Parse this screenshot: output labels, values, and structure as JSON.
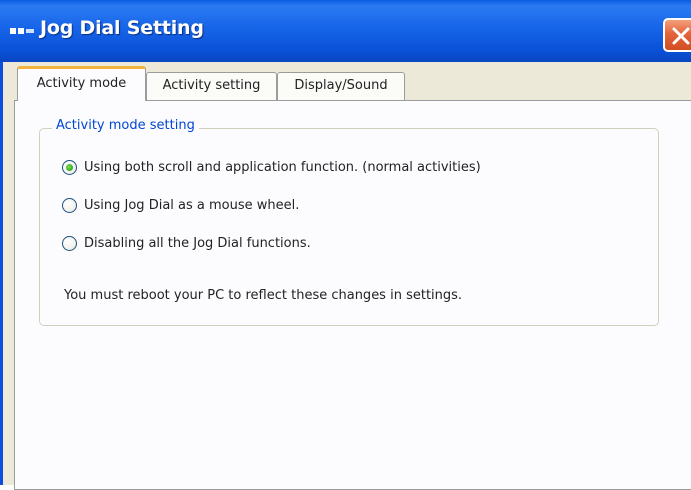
{
  "window": {
    "title": "Jog Dial Setting"
  },
  "tabs": [
    {
      "label": "Activity mode",
      "active": true
    },
    {
      "label": "Activity setting",
      "active": false
    },
    {
      "label": "Display/Sound",
      "active": false
    }
  ],
  "group": {
    "label": "Activity mode setting",
    "options": [
      {
        "label": "Using both scroll and application function. (normal activities)",
        "selected": true
      },
      {
        "label": "Using Jog Dial as a mouse wheel.",
        "selected": false
      },
      {
        "label": "Disabling all the Jog Dial functions.",
        "selected": false
      }
    ],
    "note": "You must reboot your PC to reflect these changes in settings."
  },
  "colors": {
    "titlebar": "#0a52d8",
    "group_label": "#0046d5",
    "close_button": "#e4643c",
    "active_tab_accent": "#f0b43c"
  },
  "icons": {
    "title": "jog-dial-app-icon",
    "close": "close-icon"
  }
}
